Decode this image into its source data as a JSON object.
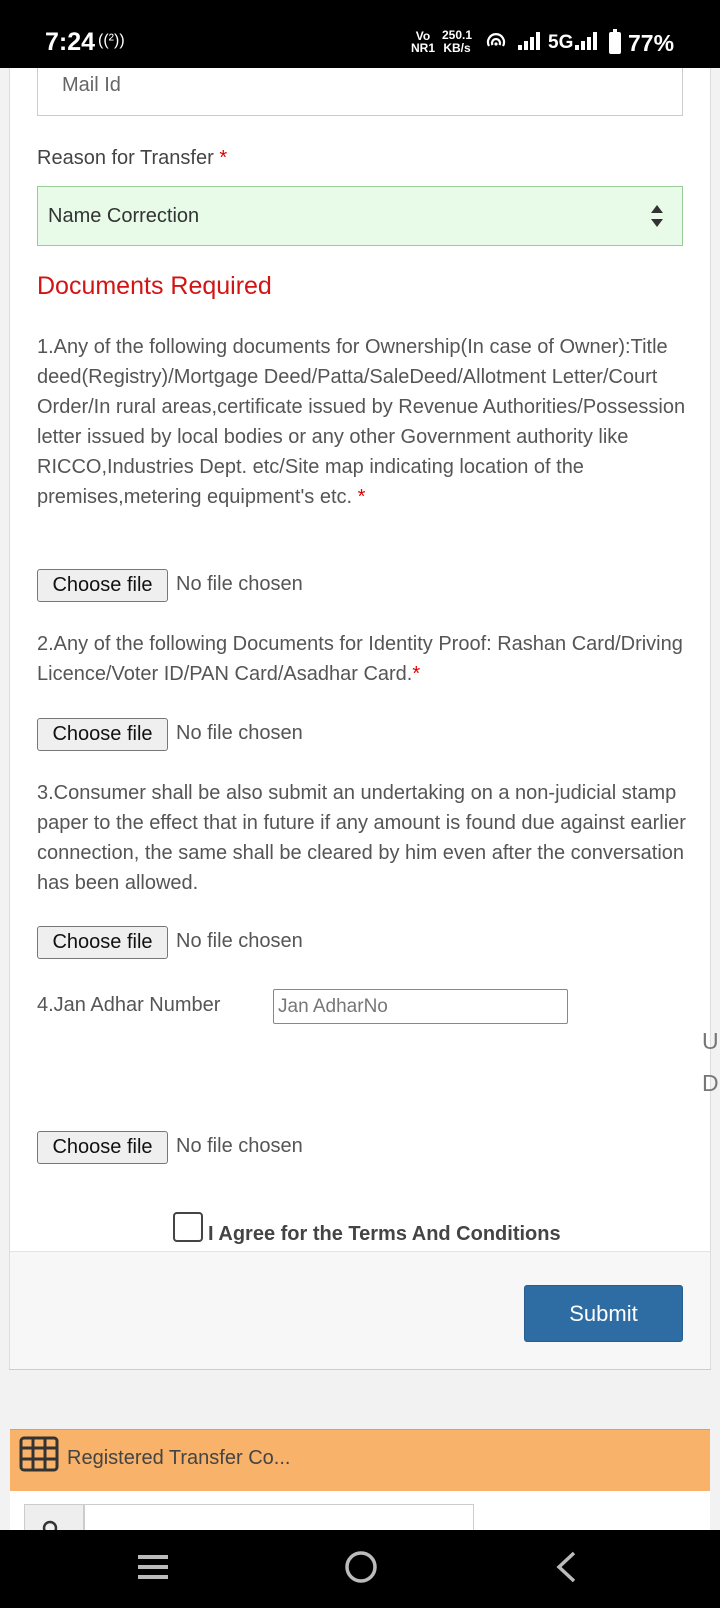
{
  "status_bar": {
    "time": "7:24",
    "hotspot": "((²))",
    "volte": [
      "Vo",
      "NR1"
    ],
    "speed": [
      "250.1",
      "KB/s"
    ],
    "network": "5G",
    "battery": "77%"
  },
  "form": {
    "mail_placeholder": "Mail Id",
    "reason_label": "Reason for Transfer",
    "required_mark": "*",
    "reason_value": "Name Correction",
    "documents_heading": "Documents Required",
    "doc1_text": "1.Any of the following documents for Ownership(In case of Owner):Title deed(Registry)/Mortgage Deed/Patta/SaleDeed/Allotment Letter/Court Order/In rural areas,certificate issued by Revenue Authorities/Possession letter issued by local bodies or any other Government authority like RICCO,Industries Dept. etc/Site map indicating location of the premises,metering equipment's etc.",
    "doc2_text": "2.Any of the following Documents for Identity Proof: Rashan Card/Driving Licence/Voter ID/PAN Card/Asadhar Card.",
    "doc3_text": "3.Consumer shall be also submit an undertaking on a non-judicial stamp paper to the effect that in future if any amount is found due against earlier connection, the same shall be cleared by him even after the conversation has been allowed.",
    "jan_label": "4.Jan Adhar Number",
    "jan_placeholder": "Jan AdharNo",
    "choose_file_label": "Choose file",
    "no_file_text": "No file chosen",
    "side_letters": [
      "U",
      "D"
    ],
    "agree_text": "I Agree for the Terms And Conditions",
    "submit_label": "Submit"
  },
  "panel": {
    "title": "Registered Transfer Co..."
  },
  "colors": {
    "heading_red": "#d21414",
    "submit_blue": "#2e6da4",
    "panel_orange": "#f8b26a",
    "select_green": "#e8fbe8"
  }
}
